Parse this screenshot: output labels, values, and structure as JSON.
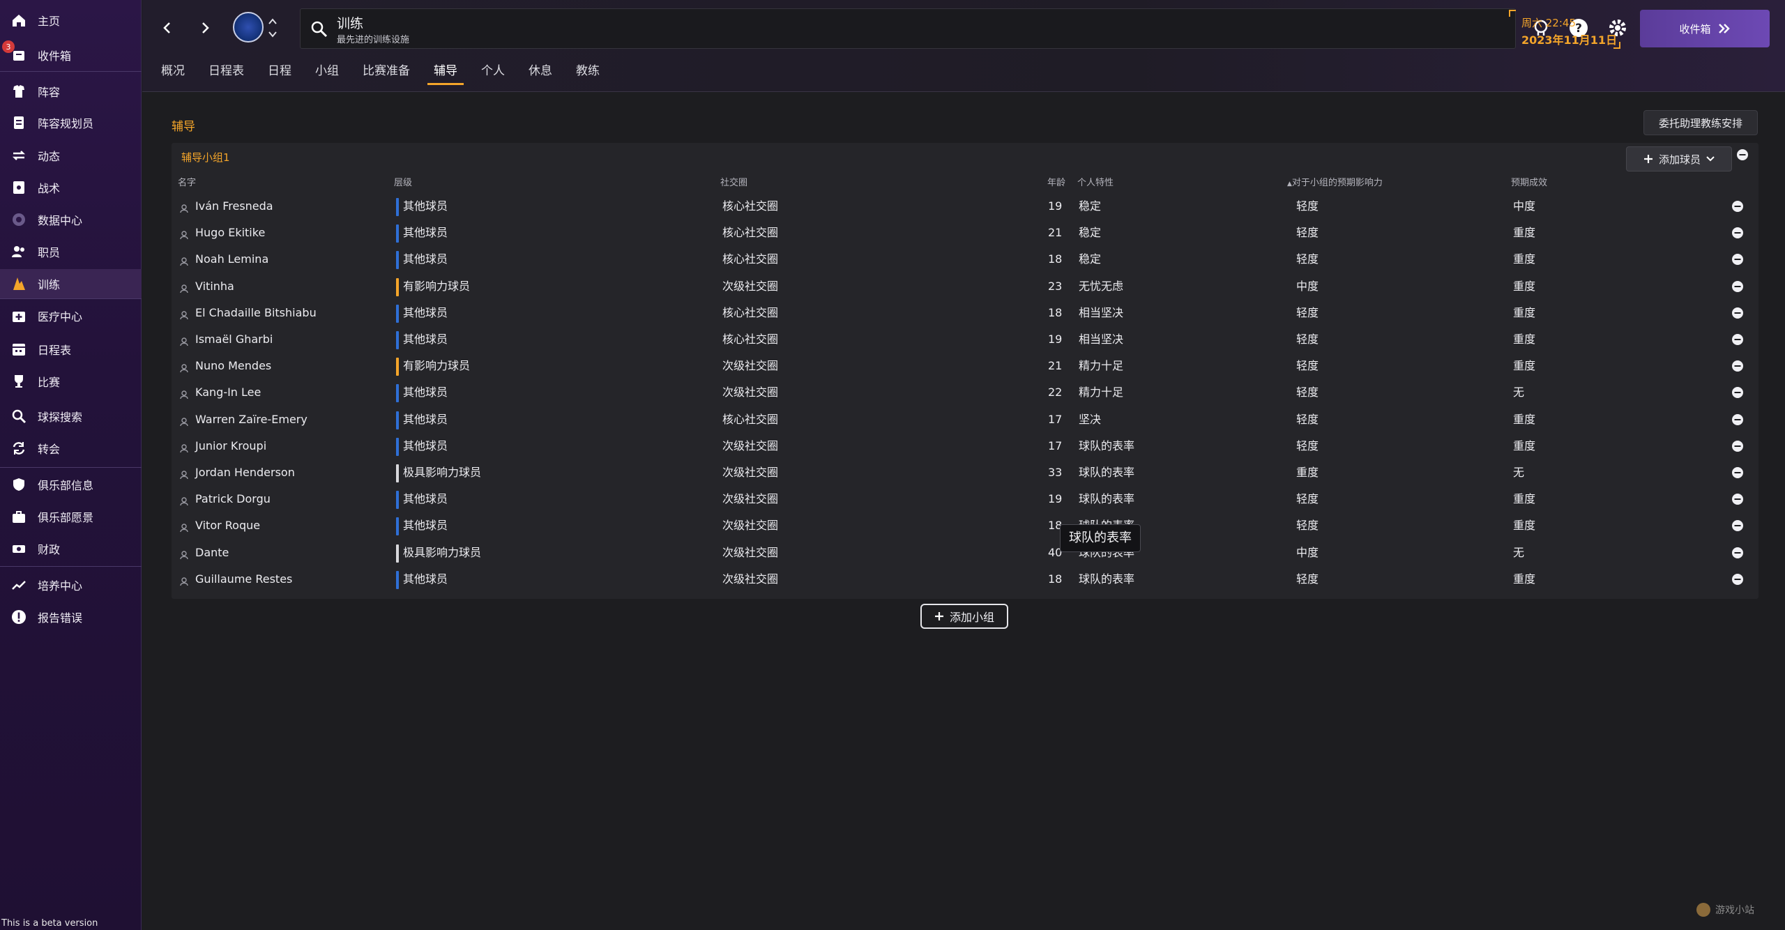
{
  "sidebar": {
    "inbox_badge": "3",
    "items": [
      {
        "label": "主页",
        "icon": "home-icon"
      },
      {
        "label": "收件箱",
        "icon": "inbox-icon"
      },
      {
        "label": "阵容",
        "icon": "squad-icon"
      },
      {
        "label": "阵容规划员",
        "icon": "planner-icon"
      },
      {
        "label": "动态",
        "icon": "dynamics-icon"
      },
      {
        "label": "战术",
        "icon": "tactics-icon"
      },
      {
        "label": "数据中心",
        "icon": "data-hub-icon"
      },
      {
        "label": "职员",
        "icon": "staff-icon"
      },
      {
        "label": "训练",
        "icon": "training-icon"
      },
      {
        "label": "医疗中心",
        "icon": "medical-icon"
      },
      {
        "label": "日程表",
        "icon": "calendar-icon"
      },
      {
        "label": "比赛",
        "icon": "trophy-icon"
      },
      {
        "label": "球探搜索",
        "icon": "scouting-icon"
      },
      {
        "label": "转会",
        "icon": "transfers-icon"
      },
      {
        "label": "俱乐部信息",
        "icon": "club-info-icon"
      },
      {
        "label": "俱乐部愿景",
        "icon": "club-vision-icon"
      },
      {
        "label": "财政",
        "icon": "finances-icon"
      },
      {
        "label": "培养中心",
        "icon": "development-icon"
      },
      {
        "label": "报告错误",
        "icon": "report-bug-icon"
      }
    ],
    "beta_note": "This is a beta version"
  },
  "topbar": {
    "search_title": "训练",
    "search_subtitle": "最先进的训练设施",
    "date_time": "周六 22:45",
    "date_day": "2023年11月11日",
    "inbox_button": "收件箱"
  },
  "tabs": [
    "概况",
    "日程表",
    "日程",
    "小组",
    "比赛准备",
    "辅导",
    "个人",
    "休息",
    "教练"
  ],
  "active_tab": "辅导",
  "main": {
    "section_title": "辅导",
    "delegate_button": "委托助理教练安排",
    "group_title": "辅导小组1",
    "add_player_button": "添加球员",
    "add_group_button": "添加小组",
    "tooltip": "球队的表率",
    "columns": {
      "name": "名字",
      "level": "层级",
      "social": "社交圈",
      "age": "年龄",
      "personality": "个人特性",
      "influence": "对于小组的预期影响力",
      "outcome": "预期成效"
    },
    "level_colors": {
      "其他球员": "#2f6fd6",
      "有影响力球员": "#f4a52a",
      "极具影响力球员": "#d8d8dc"
    },
    "rows": [
      {
        "name": "Iván Fresneda",
        "level": "其他球员",
        "social": "核心社交圈",
        "age": "19",
        "personality": "稳定",
        "influence": "轻度",
        "outcome": "中度"
      },
      {
        "name": "Hugo Ekitike",
        "level": "其他球员",
        "social": "核心社交圈",
        "age": "21",
        "personality": "稳定",
        "influence": "轻度",
        "outcome": "重度"
      },
      {
        "name": "Noah Lemina",
        "level": "其他球员",
        "social": "核心社交圈",
        "age": "18",
        "personality": "稳定",
        "influence": "轻度",
        "outcome": "重度"
      },
      {
        "name": "Vitinha",
        "level": "有影响力球员",
        "social": "次级社交圈",
        "age": "23",
        "personality": "无忧无虑",
        "influence": "中度",
        "outcome": "重度"
      },
      {
        "name": "El Chadaille Bitshiabu",
        "level": "其他球员",
        "social": "核心社交圈",
        "age": "18",
        "personality": "相当坚决",
        "influence": "轻度",
        "outcome": "重度"
      },
      {
        "name": "Ismaël Gharbi",
        "level": "其他球员",
        "social": "核心社交圈",
        "age": "19",
        "personality": "相当坚决",
        "influence": "轻度",
        "outcome": "重度"
      },
      {
        "name": "Nuno Mendes",
        "level": "有影响力球员",
        "social": "次级社交圈",
        "age": "21",
        "personality": "精力十足",
        "influence": "轻度",
        "outcome": "重度"
      },
      {
        "name": "Kang-In Lee",
        "level": "其他球员",
        "social": "次级社交圈",
        "age": "22",
        "personality": "精力十足",
        "influence": "轻度",
        "outcome": "无"
      },
      {
        "name": "Warren Zaïre-Emery",
        "level": "其他球员",
        "social": "核心社交圈",
        "age": "17",
        "personality": "坚决",
        "influence": "轻度",
        "outcome": "重度"
      },
      {
        "name": "Junior Kroupi",
        "level": "其他球员",
        "social": "次级社交圈",
        "age": "17",
        "personality": "球队的表率",
        "influence": "轻度",
        "outcome": "重度"
      },
      {
        "name": "Jordan Henderson",
        "level": "极具影响力球员",
        "social": "次级社交圈",
        "age": "33",
        "personality": "球队的表率",
        "influence": "重度",
        "outcome": "无"
      },
      {
        "name": "Patrick Dorgu",
        "level": "其他球员",
        "social": "次级社交圈",
        "age": "19",
        "personality": "球队的表率",
        "influence": "轻度",
        "outcome": "重度"
      },
      {
        "name": "Vitor Roque",
        "level": "其他球员",
        "social": "次级社交圈",
        "age": "18",
        "personality": "球队的表率",
        "influence": "轻度",
        "outcome": "重度"
      },
      {
        "name": "Dante",
        "level": "极具影响力球员",
        "social": "次级社交圈",
        "age": "40",
        "personality": "球队的表率",
        "influence": "中度",
        "outcome": "无"
      },
      {
        "name": "Guillaume Restes",
        "level": "其他球员",
        "social": "次级社交圈",
        "age": "18",
        "personality": "球队的表率",
        "influence": "轻度",
        "outcome": "重度"
      }
    ]
  },
  "watermark": "游戏小站"
}
